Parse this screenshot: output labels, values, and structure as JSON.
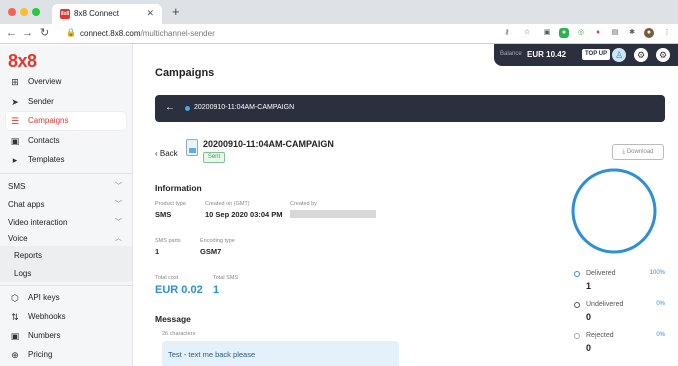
{
  "browser": {
    "tab_title": "8x8 Connect",
    "tab_favicon_text": "8x8",
    "url_host": "connect.8x8.com",
    "url_path": "/multichannel-sender"
  },
  "sidebar": {
    "logo": "8x8",
    "items": [
      {
        "label": "Overview",
        "icon": "grid-icon"
      },
      {
        "label": "Sender",
        "icon": "send-icon"
      },
      {
        "label": "Campaigns",
        "icon": "campaigns-icon"
      },
      {
        "label": "Contacts",
        "icon": "contacts-icon"
      },
      {
        "label": "Templates",
        "icon": "templates-icon"
      }
    ],
    "groups": [
      {
        "label": "SMS"
      },
      {
        "label": "Chat apps"
      },
      {
        "label": "Video interaction"
      },
      {
        "label": "Voice"
      }
    ],
    "voice_sub": [
      "Reports",
      "Logs"
    ],
    "bottom_items": [
      {
        "label": "API keys",
        "icon": "api-icon"
      },
      {
        "label": "Webhooks",
        "icon": "webhook-icon"
      },
      {
        "label": "Numbers",
        "icon": "numbers-icon"
      },
      {
        "label": "Pricing",
        "icon": "pricing-icon"
      }
    ]
  },
  "topbar": {
    "balance_label": "Balance",
    "balance_value": "EUR 10.42",
    "topup_label": "TOP UP"
  },
  "main": {
    "title": "Campaigns",
    "banner_title": "20200910-11:04AM-CAMPAIGN",
    "back_label": "Back",
    "campaign_name": "20200910-11:04AM-CAMPAIGN",
    "status": "Sent",
    "download_label": "Download",
    "information": {
      "heading": "Information",
      "product_type_label": "Product type",
      "product_type": "SMS",
      "created_on_label": "Created on (GMT)",
      "created_on": "10 Sep 2020 03:04 PM",
      "created_by_label": "Created by",
      "sms_parts_label": "SMS parts",
      "sms_parts": "1",
      "encoding_label": "Encoding type",
      "encoding": "GSM7",
      "total_cost_label": "Total cost",
      "total_cost": "EUR 0.02",
      "total_sms_label": "Total SMS",
      "total_sms": "1"
    },
    "message": {
      "heading": "Message",
      "char_count": "26 characters",
      "text": "Test - text me back please"
    },
    "stats": [
      {
        "label": "Delivered",
        "percent": "100%",
        "value": "1"
      },
      {
        "label": "Undelivered",
        "percent": "0%",
        "value": "0"
      },
      {
        "label": "Rejected",
        "percent": "0%",
        "value": "0"
      }
    ],
    "delivered_fraction": 1.0
  },
  "colors": {
    "brand_red": "#e7342d",
    "accent_blue": "#2d8fd5",
    "dark_bar": "#2b2f3e"
  }
}
